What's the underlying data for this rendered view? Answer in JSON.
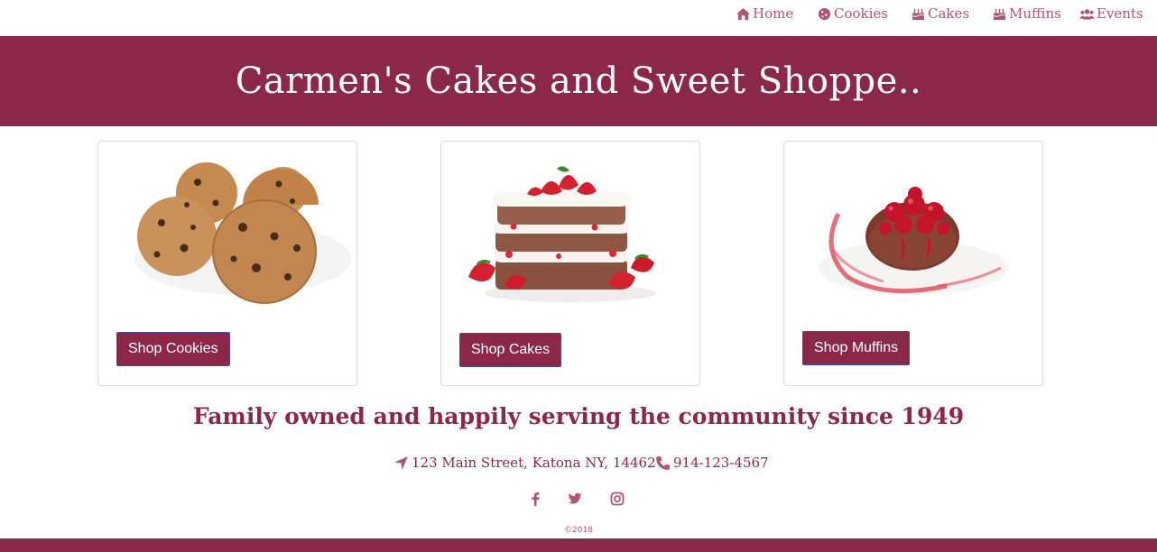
{
  "nav": {
    "items": [
      {
        "label": "Home",
        "icon": "home-icon"
      },
      {
        "label": "Cookies",
        "icon": "cookie-icon"
      },
      {
        "label": "Cakes",
        "icon": "birthday-cake-icon"
      },
      {
        "label": "Muffins",
        "icon": "birthday-cake-icon"
      },
      {
        "label": "Events",
        "icon": "users-icon"
      }
    ]
  },
  "banner": {
    "title": "Carmen's Cakes and Sweet Shoppe.."
  },
  "cards": [
    {
      "image": "chocolate-chip-cookies-photo",
      "button": "Shop Cookies"
    },
    {
      "image": "strawberry-layer-cake-photo",
      "button": "Shop Cakes"
    },
    {
      "image": "cherry-muffin-photo",
      "button": "Shop Muffins"
    }
  ],
  "tagline": "Family owned and happily serving the community since 1949",
  "contact": {
    "address": "123 Main Street, Katona NY, 14462",
    "phone": "914-123-4567"
  },
  "social": [
    "facebook-icon",
    "twitter-icon",
    "instagram-icon"
  ],
  "copyright": "©2018",
  "colors": {
    "brand": "#8b2748",
    "nav_text": "#b05577",
    "button_border": "#3f4ea1",
    "card_border": "#dcdcdc"
  }
}
